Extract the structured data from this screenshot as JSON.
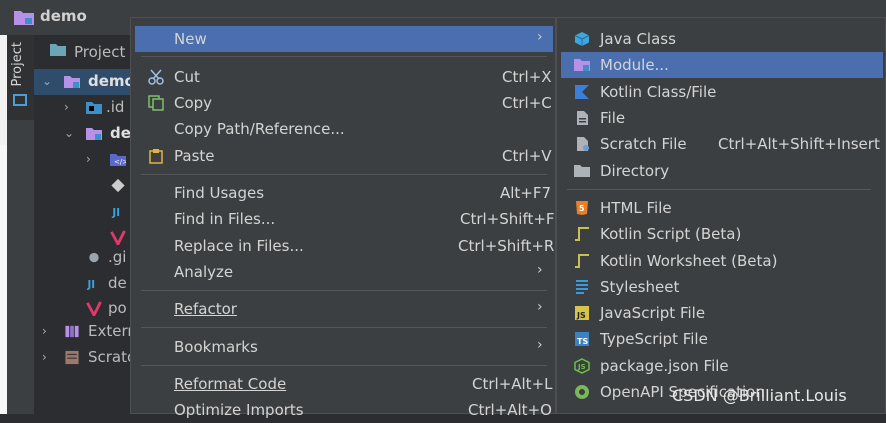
{
  "window": {
    "title": "demo"
  },
  "stripe": {
    "project_label": "Project"
  },
  "project_panel": {
    "header": "Project",
    "tree": [
      {
        "label": "demo",
        "bold": true
      },
      {
        "label": ".id"
      },
      {
        "label": "de",
        "bold": true
      },
      {
        "label": ""
      },
      {
        "label": ""
      },
      {
        "label": ""
      },
      {
        "label": ""
      },
      {
        "label": ".gi"
      },
      {
        "label": "de"
      },
      {
        "label": "po"
      },
      {
        "label": "Extern"
      },
      {
        "label": "Scrato"
      }
    ]
  },
  "context_menu": {
    "new": "New",
    "cut": "Cut",
    "cut_key": "Ctrl+X",
    "copy": "Copy",
    "copy_key": "Ctrl+C",
    "copy_path": "Copy Path/Reference...",
    "paste": "Paste",
    "paste_key": "Ctrl+V",
    "find_usages": "Find Usages",
    "find_usages_key": "Alt+F7",
    "find_in_files": "Find in Files...",
    "find_in_files_key": "Ctrl+Shift+F",
    "replace_in_files": "Replace in Files...",
    "replace_in_files_key": "Ctrl+Shift+R",
    "analyze": "Analyze",
    "refactor": "Refactor",
    "bookmarks": "Bookmarks",
    "reformat": "Reformat Code",
    "reformat_key": "Ctrl+Alt+L",
    "optimize": "Optimize Imports",
    "optimize_key": "Ctrl+Alt+O"
  },
  "new_submenu": {
    "java_class": "Java Class",
    "module": "Module...",
    "kotlin_class": "Kotlin Class/File",
    "file": "File",
    "scratch_file": "Scratch File",
    "scratch_key": "Ctrl+Alt+Shift+Insert",
    "directory": "Directory",
    "html_file": "HTML File",
    "kotlin_script": "Kotlin Script (Beta)",
    "kotlin_worksheet": "Kotlin Worksheet (Beta)",
    "stylesheet": "Stylesheet",
    "js_file": "JavaScript File",
    "ts_file": "TypeScript File",
    "package_json": "package.json File",
    "openapi": "OpenAPI Specification"
  },
  "watermark": "CSDN @Brilliant.Louis",
  "colors": {
    "highlight": "#4b6eaf",
    "menu_bg": "#3c3f41",
    "module_icon": "#b790e8"
  }
}
